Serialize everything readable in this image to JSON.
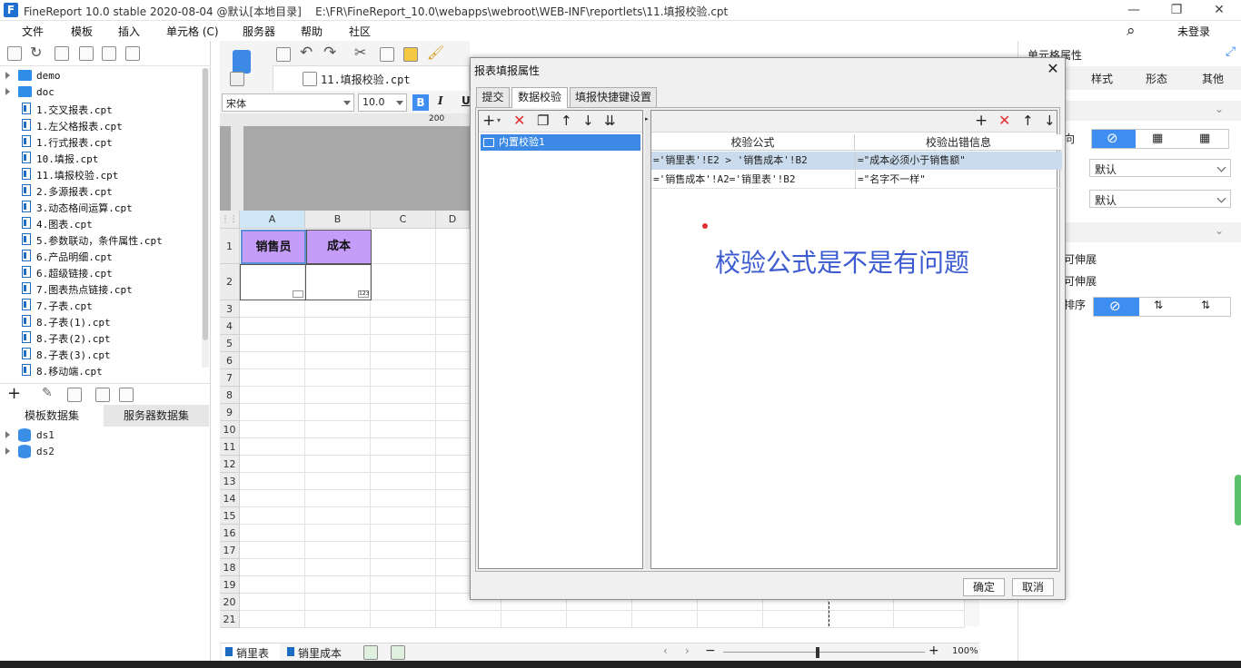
{
  "titlebar": {
    "app": "FineReport 10.0 stable 2020-08-04 @默认[本地目录]",
    "path": "E:\\FR\\FineReport_10.0\\webapps\\webroot\\WEB-INF\\reportlets\\11.填报校验.cpt",
    "logo": "F"
  },
  "menubar": {
    "items": [
      "文件",
      "模板",
      "插入",
      "单元格 (C)",
      "服务器",
      "帮助",
      "社区"
    ],
    "login": "未登录"
  },
  "tree": {
    "folders": [
      "demo",
      "doc"
    ],
    "files": [
      "1.交叉报表.cpt",
      "1.左父格报表.cpt",
      "1.行式报表.cpt",
      "10.填报.cpt",
      "11.填报校验.cpt",
      "2.多源报表.cpt",
      "3.动态格间运算.cpt",
      "4.图表.cpt",
      "5.参数联动，条件属性.cpt",
      "6.产品明细.cpt",
      "6.超级链接.cpt",
      "7.图表热点链接.cpt",
      "7.子表.cpt",
      "8.子表(1).cpt",
      "8.子表(2).cpt",
      "8.子表(3).cpt",
      "8.移动端.cpt"
    ]
  },
  "datasets": {
    "tabs": [
      "模板数据集",
      "服务器数据集"
    ],
    "items": [
      "ds1",
      "ds2"
    ]
  },
  "editor": {
    "file_tab": "11.填报校验.cpt",
    "font_name": "宋体",
    "font_size": "10.0",
    "bold": "B",
    "italic": "I",
    "underline": "U",
    "ruler_mark": "200",
    "columns": [
      "A",
      "B",
      "C",
      "D"
    ],
    "rows": [
      "1",
      "2",
      "3",
      "4",
      "5",
      "6",
      "7",
      "8",
      "9",
      "10",
      "11",
      "12",
      "13",
      "14",
      "15",
      "16",
      "17",
      "18",
      "19",
      "20",
      "21"
    ],
    "cell_a1": "销售员",
    "cell_b1": "成本",
    "sheets": [
      "销里表",
      "销里成本"
    ],
    "zoom": "100%"
  },
  "rightpanel": {
    "title": "单元格属性",
    "tabs": [
      "样式",
      "形态",
      "其他"
    ],
    "select1": "默认",
    "select2": "默认",
    "label_a": "可伸展",
    "label_b": "可伸展",
    "label_c": "排序",
    "label_d": "向"
  },
  "dialog": {
    "title": "报表填报属性",
    "tabs": [
      "提交",
      "数据校验",
      "填报快捷键设置"
    ],
    "list_items": [
      "内置校验1"
    ],
    "columns": [
      "校验公式",
      "校验出错信息"
    ],
    "rows": [
      {
        "formula": "='销里表'!E2 > '销售成本'!B2",
        "message": "=\"成本必须小于销售额\""
      },
      {
        "formula": "='销售成本'!A2='销里表'!B2",
        "message": "=\"名字不一样\""
      }
    ],
    "annotation": "校验公式是不是有问题",
    "ok": "确定",
    "cancel": "取消"
  },
  "colors": {
    "accent": "#3e8ef2",
    "header_cell": "#c59cf7",
    "selected_row": "#c9dbed",
    "annotation": "#3d5bd0",
    "delete_red": "#e03030"
  }
}
